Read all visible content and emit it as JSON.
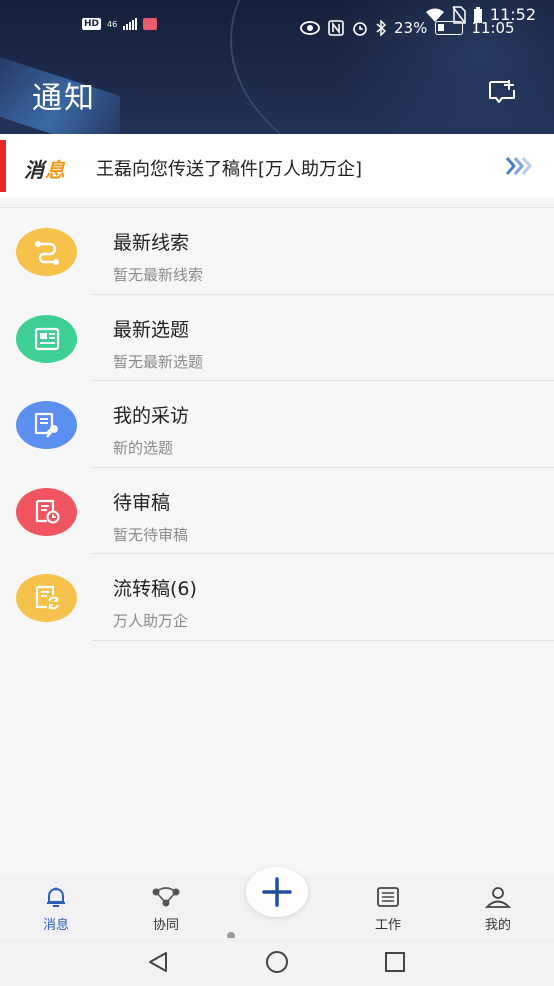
{
  "status_bar": {
    "left_badges": [
      "HD",
      "46"
    ],
    "time_top": "11:52",
    "battery": "23%",
    "time_bottom": "11:05"
  },
  "header": {
    "title": "通知",
    "action_icon": "add-note-icon"
  },
  "banner": {
    "tag_part1": "消",
    "tag_part2": "息",
    "message": "王磊向您传送了稿件[万人助万企]",
    "arrow_icon": "double-chevron-right-icon"
  },
  "items": [
    {
      "name": "最新线索",
      "sub": "暂无最新线索",
      "color": "#f7c24c",
      "icon": "link-icon"
    },
    {
      "name": "最新选题",
      "sub": "暂无最新选题",
      "color": "#3ecf95",
      "icon": "news-icon"
    },
    {
      "name": "我的采访",
      "sub": "新的选题",
      "color": "#5b8ff0",
      "icon": "interview-icon"
    },
    {
      "name": "待审稿",
      "sub": "暂无待审稿",
      "color": "#f0565f",
      "icon": "pending-review-icon"
    },
    {
      "name": "流转稿(6)",
      "sub": "万人助万企",
      "color": "#f7c24c",
      "icon": "transfer-doc-icon"
    }
  ],
  "bottom_nav": {
    "items": [
      {
        "label": "消息",
        "icon": "bell-icon",
        "active": true
      },
      {
        "label": "协同",
        "icon": "collab-icon",
        "active": false
      },
      {
        "label": "工作",
        "icon": "list-icon",
        "active": false
      },
      {
        "label": "我的",
        "icon": "person-icon",
        "active": false
      }
    ],
    "fab_icon": "plus-icon"
  },
  "system_nav": [
    "back-icon",
    "home-icon",
    "recents-icon"
  ],
  "colors": {
    "header_bg": "#1c2a4a",
    "accent": "#2a5fb8",
    "banner_red": "#e8262b",
    "tag_orange": "#f39a1d"
  }
}
